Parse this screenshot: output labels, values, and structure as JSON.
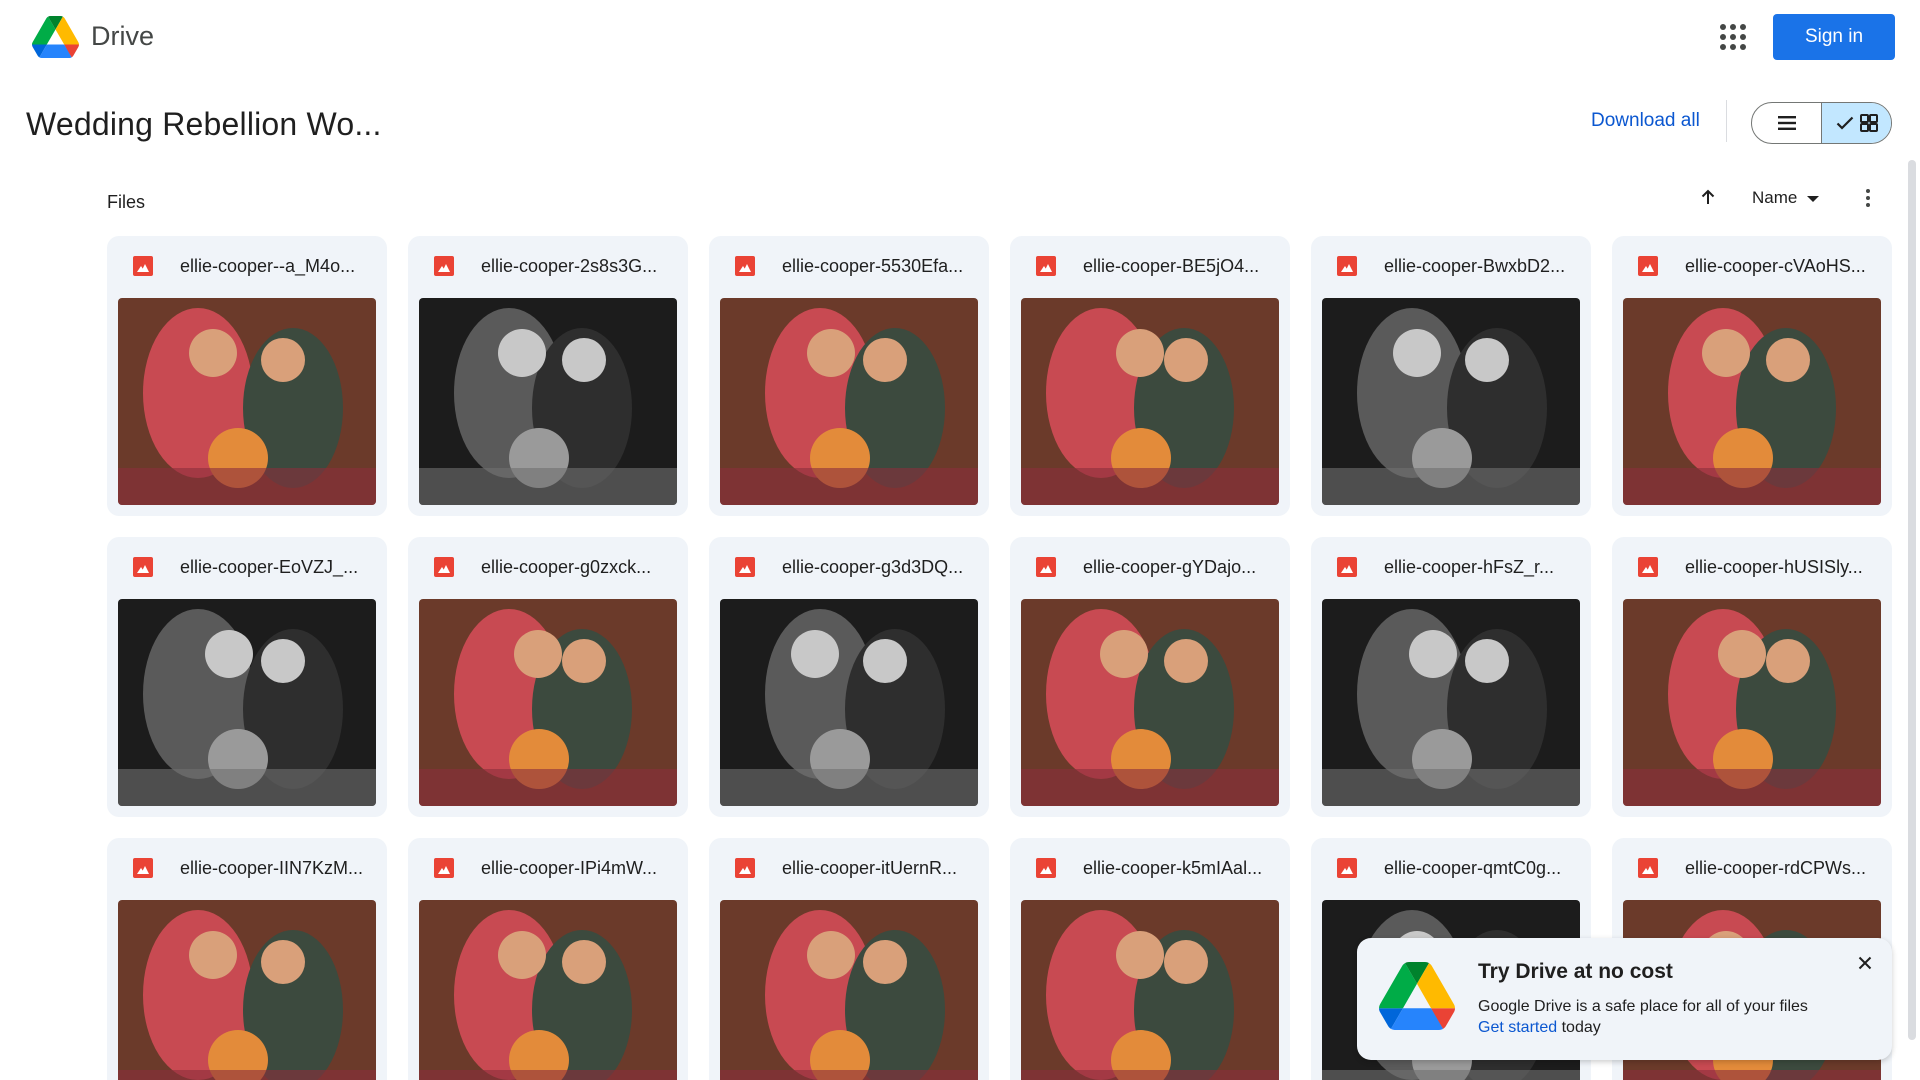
{
  "app": {
    "name": "Drive",
    "logo_icon": "google-drive-logo-icon",
    "apps_icon": "apps-grid-icon",
    "signin_label": "Sign in"
  },
  "colors": {
    "accent": "#1a73e8",
    "link": "#0b57d0",
    "card_bg": "#f0f4f9",
    "image_icon": "#ea4335",
    "toggle_active": "#c2e7ff"
  },
  "header": {
    "title": "Wedding Rebellion Wo...",
    "download_all_label": "Download all",
    "views": [
      {
        "name": "list",
        "icon": "list-view-icon",
        "selected": false
      },
      {
        "name": "grid",
        "icon": "grid-view-icon",
        "selected": true
      }
    ]
  },
  "files_toolbar": {
    "section_label": "Files",
    "sort_direction_icon": "arrow-up-icon",
    "sort_by": "Name",
    "more_icon": "more-vert-icon"
  },
  "files": [
    {
      "name": "ellie-cooper--a_M4o...",
      "thumb": "color"
    },
    {
      "name": "ellie-cooper-2s8s3G...",
      "thumb": "bw"
    },
    {
      "name": "ellie-cooper-5530Efa...",
      "thumb": "color"
    },
    {
      "name": "ellie-cooper-BE5jO4...",
      "thumb": "color"
    },
    {
      "name": "ellie-cooper-BwxbD2...",
      "thumb": "bw"
    },
    {
      "name": "ellie-cooper-cVAoHS...",
      "thumb": "color"
    },
    {
      "name": "ellie-cooper-EoVZJ_...",
      "thumb": "bw"
    },
    {
      "name": "ellie-cooper-g0zxck...",
      "thumb": "color"
    },
    {
      "name": "ellie-cooper-g3d3DQ...",
      "thumb": "bw"
    },
    {
      "name": "ellie-cooper-gYDajo...",
      "thumb": "color"
    },
    {
      "name": "ellie-cooper-hFsZ_r...",
      "thumb": "bw"
    },
    {
      "name": "ellie-cooper-hUSISly...",
      "thumb": "color"
    },
    {
      "name": "ellie-cooper-IIN7KzM...",
      "thumb": "color"
    },
    {
      "name": "ellie-cooper-IPi4mW...",
      "thumb": "color"
    },
    {
      "name": "ellie-cooper-itUernR...",
      "thumb": "color"
    },
    {
      "name": "ellie-cooper-k5mIAal...",
      "thumb": "color"
    },
    {
      "name": "ellie-cooper-qmtC0g...",
      "thumb": "bw"
    },
    {
      "name": "ellie-cooper-rdCPWs...",
      "thumb": "color"
    }
  ],
  "promo": {
    "title": "Try Drive at no cost",
    "text": "Google Drive is a safe place for all of your files",
    "link": "Get started",
    "suffix": " today",
    "close_icon": "close-icon"
  }
}
